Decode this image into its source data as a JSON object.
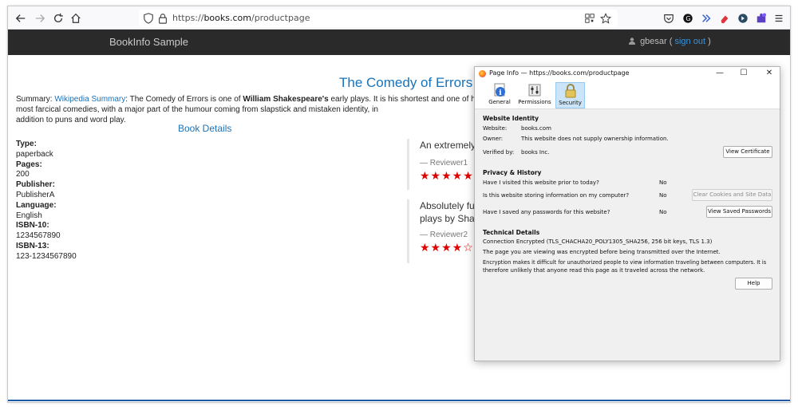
{
  "browser": {
    "url_scheme": "https://",
    "url_host": "books.com",
    "url_path": "/productpage",
    "icons": [
      "back-icon",
      "forward-icon",
      "reload-icon",
      "home-icon",
      "shield-icon",
      "lock-icon",
      "qr-icon",
      "star-icon",
      "pocket-icon",
      "extension-icon",
      "menu-icon"
    ]
  },
  "appbar": {
    "title": "BookInfo Sample",
    "user": "gbesar",
    "signout_open": " ( ",
    "signout": "sign out",
    "signout_close": " )"
  },
  "product": {
    "title": "The Comedy of Errors",
    "summary_label": "Summary: ",
    "wiki_link": "Wikipedia Summary",
    "summary_a": ": The Comedy of Errors is one of ",
    "summary_bold": "William Shakespeare's",
    "summary_b": " early plays. It is his shortest and one of his most farcical comedies, with a major part of the humour coming from slapstick and mistaken identity, in",
    "summary_c": "addition to puns and word play.",
    "details_heading": "Book Details",
    "details": [
      {
        "key": "Type:",
        "value": "paperback"
      },
      {
        "key": "Pages:",
        "value": "200"
      },
      {
        "key": "Publisher:",
        "value": "PublisherA"
      },
      {
        "key": "Language:",
        "value": "English"
      },
      {
        "key": "ISBN-10:",
        "value": "1234567890"
      },
      {
        "key": "ISBN-13:",
        "value": "123-1234567890"
      }
    ],
    "reviews": [
      {
        "text1": "An extremely entertaining play by Shakespeare. The slapstick humour is refreshing!",
        "text2": "",
        "reviewer": "— Reviewer1",
        "stars": "★★★★★",
        "rating": 5
      },
      {
        "text1": "Absolutely fun and entertaining. The play lacks thematic depth when compared to other",
        "text2": "plays by Shakespeare.",
        "reviewer": "— Reviewer2",
        "stars": "★★★★☆",
        "rating": 4
      }
    ]
  },
  "dialog": {
    "title": "Page Info — https://books.com/productpage",
    "tabs": [
      "General",
      "Permissions",
      "Security"
    ],
    "active_tab": "Security",
    "identity_heading": "Website Identity",
    "website_label": "Website:",
    "website_value": "books.com",
    "owner_label": "Owner:",
    "owner_value": "This website does not supply ownership information.",
    "verified_label": "Verified by:",
    "verified_value": "books Inc.",
    "view_cert": "View Certificate",
    "privacy_heading": "Privacy & History",
    "q1": "Have I visited this website prior to today?",
    "a1": "No",
    "q2": "Is this website storing information on my computer?",
    "a2": "No",
    "clear_btn": "Clear Cookies and Site Data",
    "q3": "Have I saved any passwords for this website?",
    "a3": "No",
    "saved_btn": "View Saved Passwords",
    "tech_heading": "Technical Details",
    "tech1": "Connection Encrypted (TLS_CHACHA20_POLY1305_SHA256, 256 bit keys, TLS 1.3)",
    "tech2": "The page you are viewing was encrypted before being transmitted over the Internet.",
    "tech3": "Encryption makes it difficult for unauthorized people to view information traveling between computers. It is",
    "tech4": "therefore unlikely that anyone read this page as it traveled across the network.",
    "help": "Help"
  },
  "colors": {
    "link": "#1a73b8",
    "star": "#e00000",
    "appbar": "#2a2a2a",
    "active_tab": "#cce4f7"
  }
}
